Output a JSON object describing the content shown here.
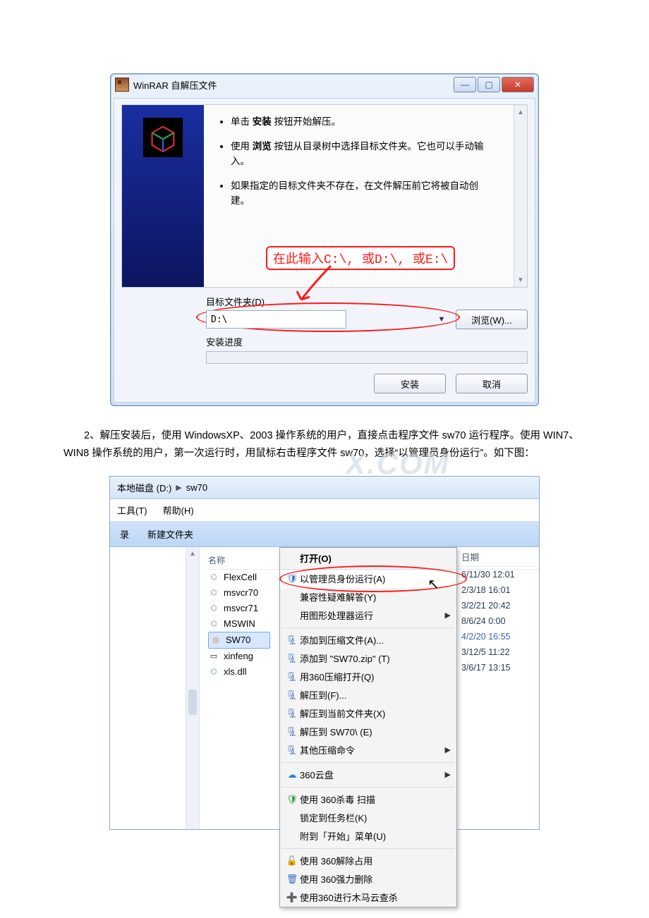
{
  "winrar": {
    "title": "WinRAR 自解压文件",
    "bullet1_pre": "单击 ",
    "bullet1_b": "安装",
    "bullet1_post": " 按钮开始解压。",
    "bullet2_pre": "使用 ",
    "bullet2_b": "浏览",
    "bullet2_post": " 按钮从目录树中选择目标文件夹。它也可以手动输入。",
    "bullet3": "如果指定的目标文件夹不存在，在文件解压前它将被自动创建。",
    "dest_label": "目标文件夹(D)",
    "dest_value": "D:\\",
    "browse_label": "浏览(W)...",
    "progress_label": "安装进度",
    "install_label": "安装",
    "cancel_label": "取消",
    "anno_hint": "在此输入C:\\, 或D:\\, 或E:\\"
  },
  "paragraph": "2、解压安装后，使用 WindowsXP、2003 操作系统的用户，直接点击程序文件 sw70 运行程序。使用 WIN7、WIN8 操作系统的用户，第一次运行时，用鼠标右击程序文件 sw70，选择“以管理员身份运行”。如下图：",
  "watermark": "X.COM",
  "explorer": {
    "crumb_root": "本地磁盘 (D:)",
    "crumb_leaf": "sw70",
    "menu_tools": "工具(T)",
    "menu_help": "帮助(H)",
    "toolbar_left": "录",
    "toolbar_new": "新建文件夹",
    "col_name": "名称",
    "col_date_suffix": "日期",
    "files": {
      "f0": "FlexCell",
      "f1": "msvcr70",
      "f2": "msvcr71",
      "f3": "MSWIN",
      "f4": "SW70",
      "f5": "xinfeng",
      "f6": "xls.dll"
    },
    "dates": {
      "d0": "6/11/30 12:01",
      "d1": "2/3/18 16:01",
      "d2": "3/2/21 20:42",
      "d3": "8/6/24 0:00",
      "d4": "4/2/20 16:55",
      "d5": "3/12/5 11:22",
      "d6": "3/6/17 13:15"
    }
  },
  "ctx": {
    "open": "打开(O)",
    "admin": "以管理员身份运行(A)",
    "compat": "兼容性疑难解答(Y)",
    "gfx": "用图形处理器运行",
    "addarch": "添加到压缩文件(A)...",
    "addzip": "添加到 \"SW70.zip\" (T)",
    "openwith360": "用360压缩打开(Q)",
    "extractto": "解压到(F)...",
    "extracthere": "解压到当前文件夹(X)",
    "extractsw70": "解压到 SW70\\ (E)",
    "otherzip": "其他压缩命令",
    "cloud360": "360云盘",
    "scan360": "使用 360杀毒 扫描",
    "pin": "锁定到任务栏(K)",
    "startmenu": "附到「开始」菜单(U)",
    "unlock360": "使用 360解除占用",
    "forcedel": "使用 360强力删除",
    "trojan": "使用360进行木马云查杀"
  }
}
